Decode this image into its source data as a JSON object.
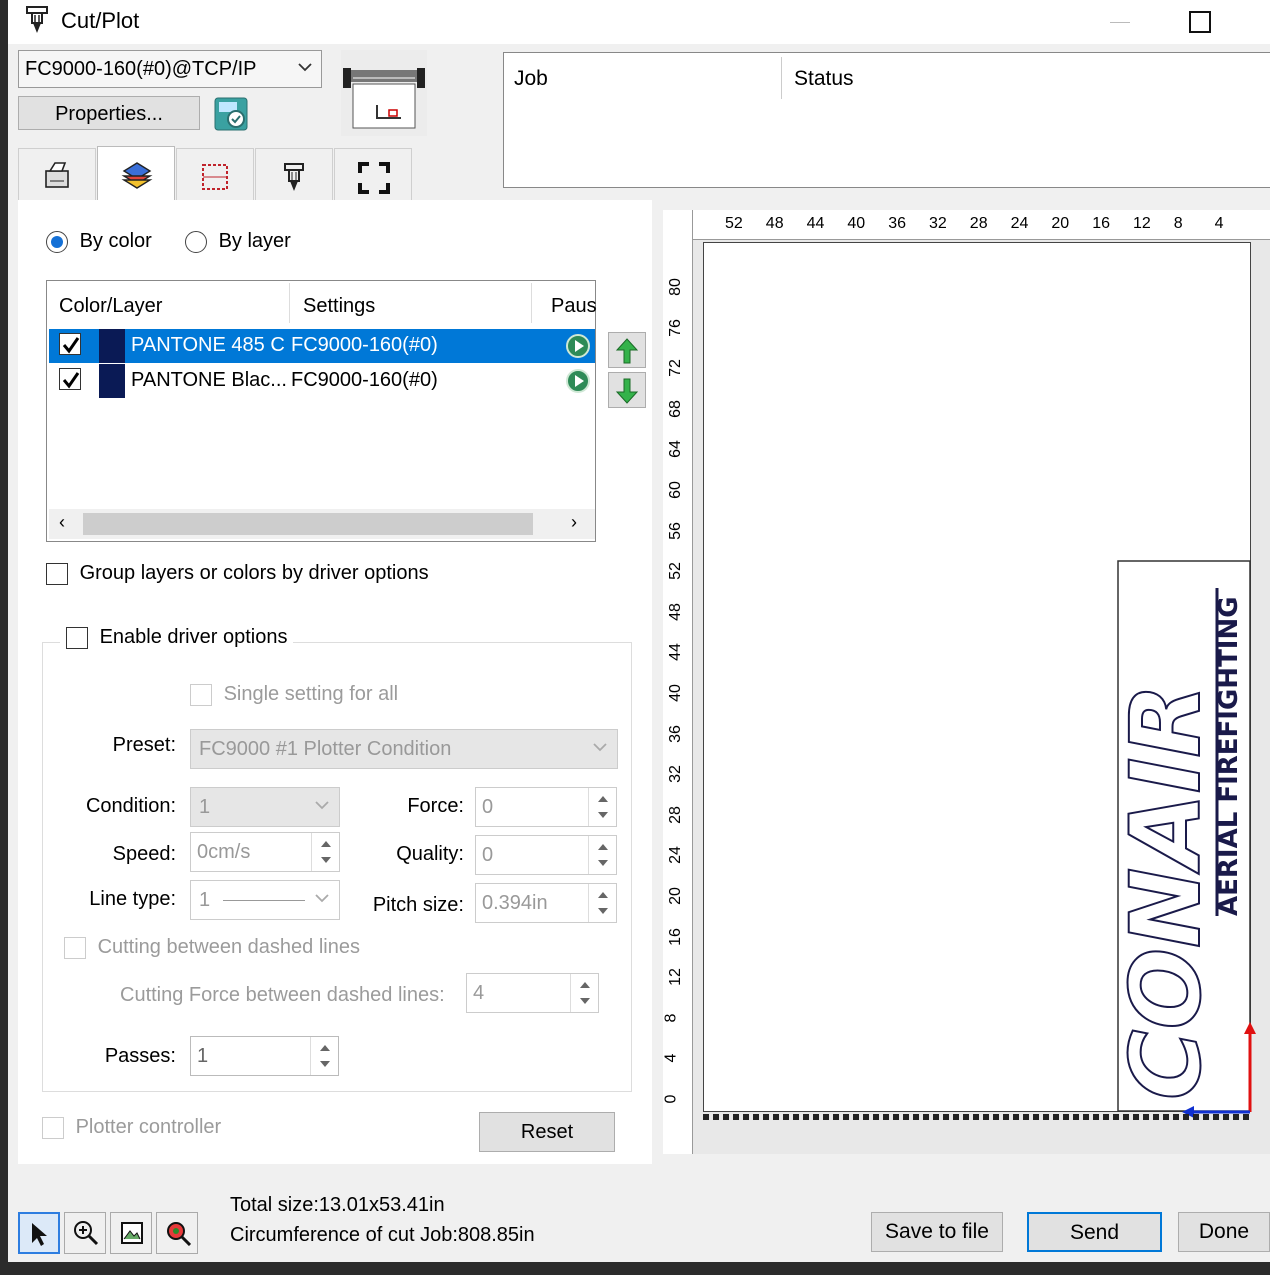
{
  "window": {
    "title": "Cut/Plot"
  },
  "device": {
    "selected": "FC9000-160(#0)@TCP/IP",
    "properties_label": "Properties..."
  },
  "job_table": {
    "columns": [
      "Job",
      "Status"
    ]
  },
  "tabs": [
    {
      "icon": "printer-icon"
    },
    {
      "icon": "layers-icon",
      "active": true
    },
    {
      "icon": "crop-frame-icon"
    },
    {
      "icon": "cutter-tool-icon"
    },
    {
      "icon": "fullscreen-icon"
    }
  ],
  "mode": {
    "by_color": "By color",
    "by_layer": "By layer",
    "selected": "by_color"
  },
  "layer_list": {
    "headers": [
      "Color/Layer",
      "Settings",
      "Paus"
    ],
    "rows": [
      {
        "name": "PANTONE 485 C",
        "settings": "FC9000-160(#0)",
        "checked": true,
        "selected": true,
        "swatch": "#0a1a55"
      },
      {
        "name": "PANTONE Blac...",
        "settings": "FC9000-160(#0)",
        "checked": true,
        "selected": false,
        "swatch": "#0a1a55"
      }
    ]
  },
  "options": {
    "group_layers": "Group layers or colors by driver options",
    "enable_driver": "Enable driver options",
    "single_setting": "Single setting for all",
    "preset_label": "Preset:",
    "preset_value": "FC9000 #1 Plotter Condition",
    "condition_label": "Condition:",
    "condition_value": "1",
    "force_label": "Force:",
    "force_value": "0",
    "speed_label": "Speed:",
    "speed_value": "0cm/s",
    "quality_label": "Quality:",
    "quality_value": "0",
    "linetype_label": "Line type:",
    "linetype_value": "1",
    "pitch_label": "Pitch size:",
    "pitch_value": "0.394in",
    "cut_dashed": "Cutting between dashed lines",
    "cut_force_dashed_label": "Cutting Force between dashed lines:",
    "cut_force_dashed_value": "4",
    "passes_label": "Passes:",
    "passes_value": "1",
    "plotter_controller": "Plotter controller",
    "reset": "Reset"
  },
  "preview": {
    "top_ruler": [
      "52",
      "48",
      "44",
      "40",
      "36",
      "32",
      "28",
      "24",
      "20",
      "16",
      "12",
      "8",
      "4"
    ],
    "left_ruler": [
      "80",
      "76",
      "72",
      "68",
      "64",
      "60",
      "56",
      "52",
      "48",
      "44",
      "40",
      "36",
      "32",
      "28",
      "24",
      "20",
      "16",
      "12",
      "8",
      "4",
      "0"
    ],
    "logo_main": "CONAIR",
    "logo_sub": "AERIAL FIREFIGHTING"
  },
  "footer": {
    "total_size": "Total size:13.01x53.41in",
    "circumference": "Circumference of cut Job:808.85in",
    "save_to_file": "Save to file",
    "send": "Send",
    "done": "Done"
  },
  "colors": {
    "accent": "#0078d7",
    "swatch": "#0a1a55",
    "arrow_red": "#e01010",
    "arrow_blue": "#1030d0"
  }
}
